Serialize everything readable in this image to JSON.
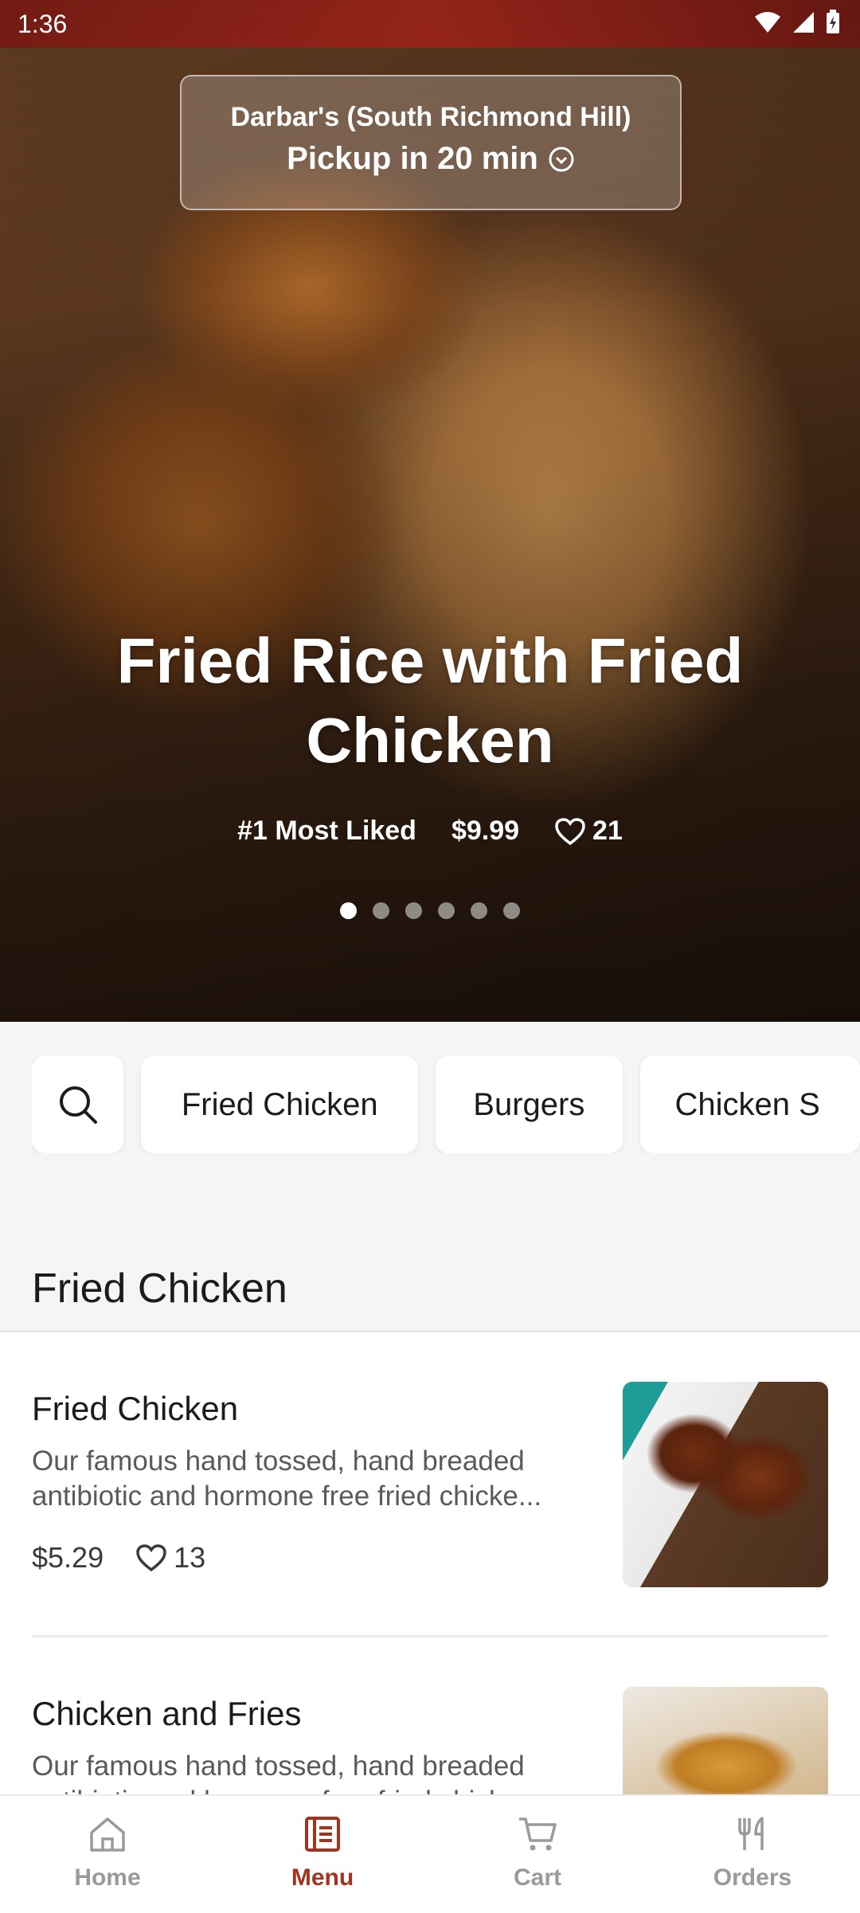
{
  "status_bar": {
    "time": "1:36"
  },
  "pickup": {
    "store": "Darbar's (South Richmond Hill)",
    "time": "Pickup in 20 min"
  },
  "hero": {
    "title": "Fried Rice with Fried Chicken",
    "rank": "#1 Most Liked",
    "price": "$9.99",
    "likes": "21",
    "carousel_count": 6,
    "carousel_active": 1
  },
  "categories": [
    "Fried Chicken",
    "Burgers",
    "Chicken S"
  ],
  "section": {
    "title": "Fried Chicken"
  },
  "items": [
    {
      "name": "Fried Chicken",
      "description": "Our famous hand tossed, hand breaded antibiotic and hormone free fried chicke...",
      "price": "$5.29",
      "likes": "13"
    },
    {
      "name": "Chicken and Fries",
      "description": "Our famous hand tossed, hand breaded antibiotic and hormone free fried chicke..."
    }
  ],
  "nav": [
    {
      "label": "Home",
      "icon": "home-icon"
    },
    {
      "label": "Menu",
      "icon": "menu-icon",
      "active": true
    },
    {
      "label": "Cart",
      "icon": "cart-icon"
    },
    {
      "label": "Orders",
      "icon": "utensils-icon"
    }
  ],
  "colors": {
    "accent": "#a3321f",
    "inactive": "#9a9a9a"
  }
}
